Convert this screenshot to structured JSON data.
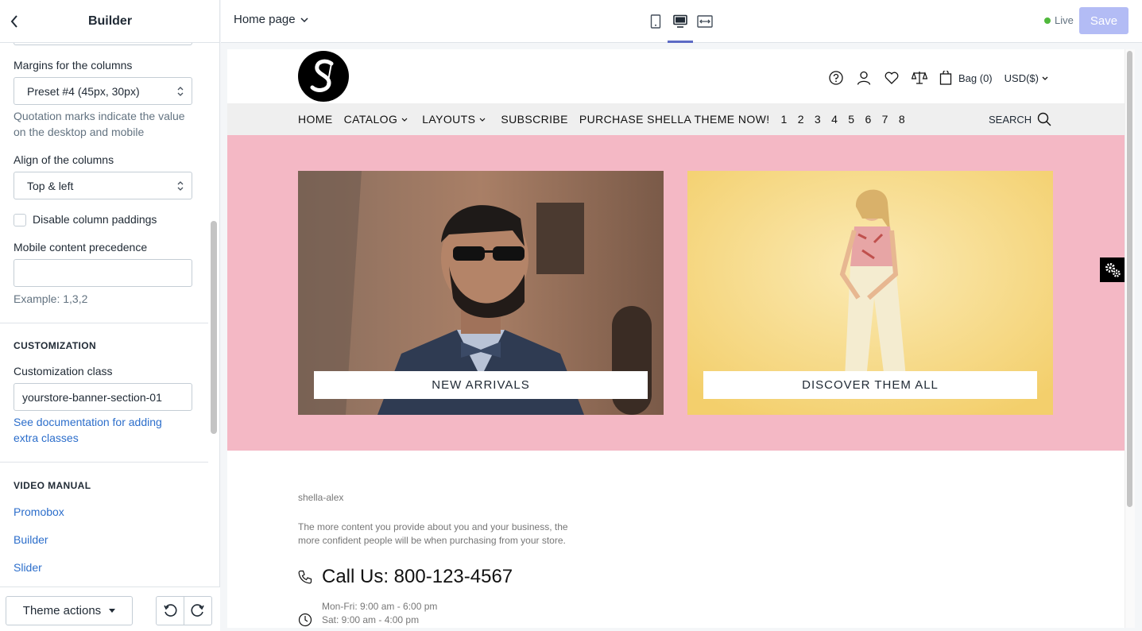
{
  "sidebar": {
    "title": "Builder",
    "margins": {
      "label": "Margins for the columns",
      "value": "Preset #4 (45px, 30px)",
      "help": "Quotation marks indicate the value on the desktop and mobile"
    },
    "align": {
      "label": "Align of the columns",
      "value": "Top & left"
    },
    "disable_paddings_label": "Disable column paddings",
    "mobile_precedence": {
      "label": "Mobile content precedence",
      "value": "",
      "help": "Example: 1,3,2"
    },
    "customization": {
      "heading": "CUSTOMIZATION",
      "class_label": "Customization class",
      "class_value": "yourstore-banner-section-01",
      "doc_link": "See documentation for adding extra classes"
    },
    "video_manual": {
      "heading": "VIDEO MANUAL",
      "links": [
        "Promobox",
        "Builder",
        "Slider"
      ]
    },
    "footer": {
      "theme_actions": "Theme actions"
    }
  },
  "topbar": {
    "page": "Home page",
    "live_label": "Live",
    "save_label": "Save",
    "colors": {
      "accent": "#5c6ac4",
      "live": "#50b83c",
      "save_disabled": "#b3bcf5"
    }
  },
  "store": {
    "bag_label": "Bag (0)",
    "currency": "USD($)",
    "nav": [
      "HOME",
      "CATALOG",
      "LAYOUTS",
      "SUBSCRIBE",
      "PURCHASE SHELLA THEME NOW!",
      "1",
      "2",
      "3",
      "4",
      "5",
      "6",
      "7",
      "8"
    ],
    "search_label": "SEARCH",
    "banner_color": "#f4b8c5",
    "tiles": [
      {
        "label": "NEW ARRIVALS"
      },
      {
        "label": "DISCOVER THEM ALL"
      }
    ],
    "footer_info": {
      "store_name": "shella-alex",
      "description": "The more content you provide about you and your business, the more confident people will be when purchasing from your store.",
      "call": "Call Us: 800-123-4567",
      "hours_weekday": "Mon-Fri: 9:00 am - 6:00 pm",
      "hours_sat": "Sat: 9:00 am - 4:00 pm"
    }
  }
}
